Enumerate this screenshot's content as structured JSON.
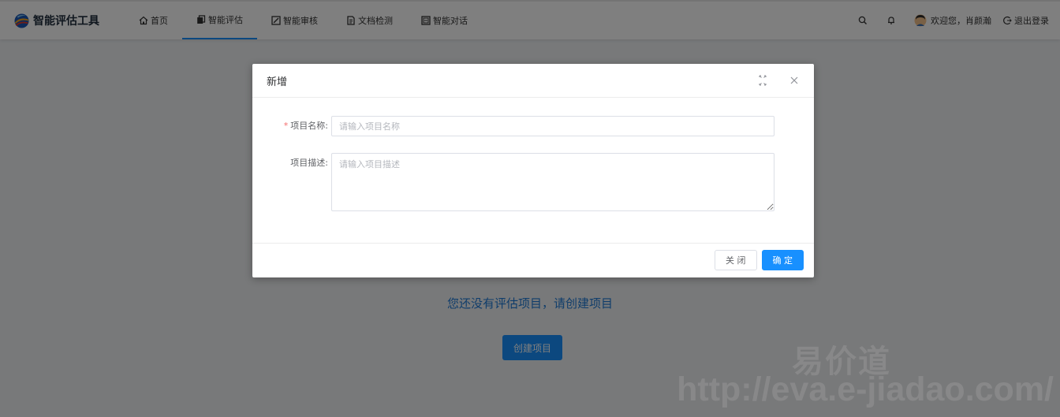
{
  "header": {
    "brand_title": "智能评估工具",
    "nav": [
      {
        "label": "首页",
        "icon": "home-icon",
        "active": false
      },
      {
        "label": "智能评估",
        "icon": "copy-icon",
        "active": true
      },
      {
        "label": "智能审核",
        "icon": "audit-icon",
        "active": false
      },
      {
        "label": "文档检测",
        "icon": "document-icon",
        "active": false
      },
      {
        "label": "智能对话",
        "icon": "chat-icon",
        "active": false
      }
    ],
    "welcome_text": "欢迎您，肖颜瀚",
    "logout_label": "退出登录"
  },
  "main": {
    "empty_message": "您还没有评估项目，请创建项目",
    "create_button_label": "创建项目"
  },
  "modal": {
    "title": "新增",
    "fields": {
      "name": {
        "label": "项目名称:",
        "required": true,
        "value": "",
        "placeholder": "请输入项目名称"
      },
      "description": {
        "label": "项目描述:",
        "required": false,
        "value": "",
        "placeholder": "请输入项目描述"
      }
    },
    "close_button_label": "关 闭",
    "confirm_button_label": "确 定"
  },
  "watermark": {
    "text_cn": "易价道",
    "url": "http://eva.e-jiadao.com/"
  },
  "colors": {
    "primary": "#1890ff",
    "link": "#1f7ad6",
    "required": "#f56c6c"
  }
}
